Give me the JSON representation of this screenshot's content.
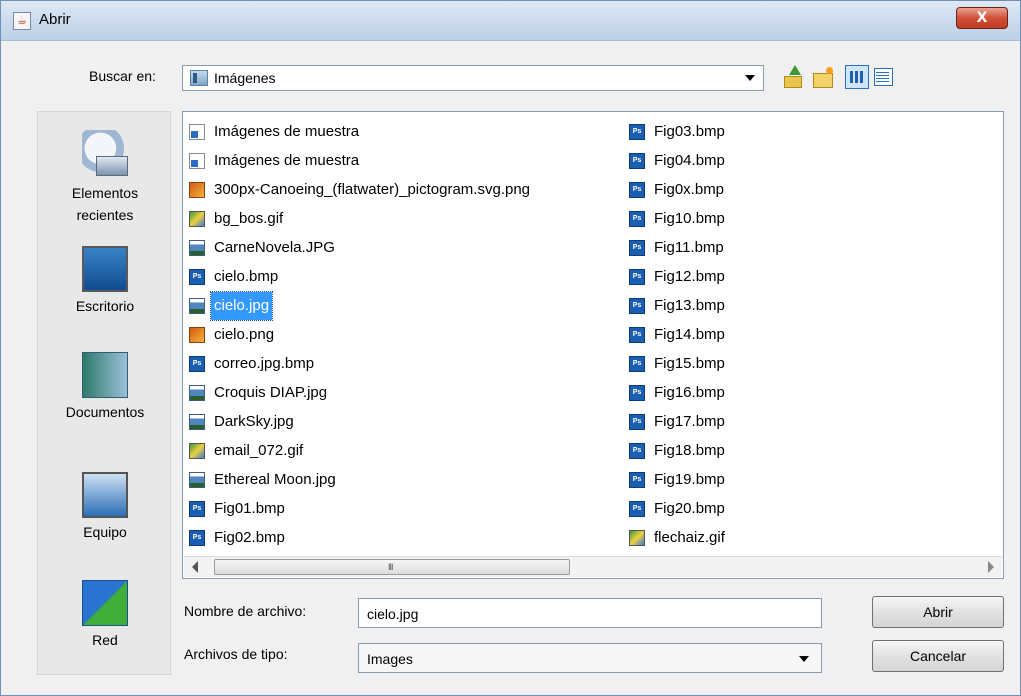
{
  "window": {
    "title": "Abrir",
    "close_label": "X"
  },
  "look_in": {
    "label": "Buscar en:",
    "value": "Imágenes"
  },
  "toolbar": {
    "buttons": [
      "up-one-level-icon",
      "create-new-folder-icon",
      "list-view-icon",
      "details-view-icon"
    ]
  },
  "places": [
    {
      "label": "Elementos\nrecientes",
      "icon": "recent-items-icon"
    },
    {
      "label": "Escritorio",
      "icon": "desktop-icon"
    },
    {
      "label": "Documentos",
      "icon": "documents-icon"
    },
    {
      "label": "Equipo",
      "icon": "computer-icon"
    },
    {
      "label": "Red",
      "icon": "network-icon"
    }
  ],
  "files_col1": [
    {
      "name": "Imágenes de muestra",
      "icon": "shortcut-folder-icon"
    },
    {
      "name": "Imágenes de muestra",
      "icon": "shortcut-folder-icon"
    },
    {
      "name": "300px-Canoeing_(flatwater)_pictogram.svg.png",
      "icon": "png-file-icon"
    },
    {
      "name": "bg_bos.gif",
      "icon": "gif-file-icon"
    },
    {
      "name": "CarneNovela.JPG",
      "icon": "jpg-file-icon"
    },
    {
      "name": "cielo.bmp",
      "icon": "bmp-file-icon"
    },
    {
      "name": "cielo.jpg",
      "icon": "jpg-file-icon",
      "selected": true
    },
    {
      "name": "cielo.png",
      "icon": "png-file-icon"
    },
    {
      "name": "correo.jpg.bmp",
      "icon": "bmp-file-icon"
    },
    {
      "name": "Croquis DIAP.jpg",
      "icon": "jpg-file-icon"
    },
    {
      "name": "DarkSky.jpg",
      "icon": "jpg-file-icon"
    },
    {
      "name": "email_072.gif",
      "icon": "gif-file-icon"
    },
    {
      "name": "Ethereal Moon.jpg",
      "icon": "jpg-file-icon"
    },
    {
      "name": "Fig01.bmp",
      "icon": "bmp-file-icon"
    },
    {
      "name": "Fig02.bmp",
      "icon": "bmp-file-icon"
    }
  ],
  "files_col2": [
    {
      "name": "Fig03.bmp",
      "icon": "bmp-file-icon"
    },
    {
      "name": "Fig04.bmp",
      "icon": "bmp-file-icon"
    },
    {
      "name": "Fig0x.bmp",
      "icon": "bmp-file-icon"
    },
    {
      "name": "Fig10.bmp",
      "icon": "bmp-file-icon"
    },
    {
      "name": "Fig11.bmp",
      "icon": "bmp-file-icon"
    },
    {
      "name": "Fig12.bmp",
      "icon": "bmp-file-icon"
    },
    {
      "name": "Fig13.bmp",
      "icon": "bmp-file-icon"
    },
    {
      "name": "Fig14.bmp",
      "icon": "bmp-file-icon"
    },
    {
      "name": "Fig15.bmp",
      "icon": "bmp-file-icon"
    },
    {
      "name": "Fig16.bmp",
      "icon": "bmp-file-icon"
    },
    {
      "name": "Fig17.bmp",
      "icon": "bmp-file-icon"
    },
    {
      "name": "Fig18.bmp",
      "icon": "bmp-file-icon"
    },
    {
      "name": "Fig19.bmp",
      "icon": "bmp-file-icon"
    },
    {
      "name": "Fig20.bmp",
      "icon": "bmp-file-icon"
    },
    {
      "name": "flechaiz.gif",
      "icon": "gif-file-icon"
    }
  ],
  "file_name": {
    "label": "Nombre de archivo:",
    "value": "cielo.jpg"
  },
  "file_type": {
    "label": "Archivos de tipo:",
    "value": "Images"
  },
  "buttons": {
    "open_label": "Abrir",
    "cancel_label": "Cancelar"
  },
  "scrollbar": {
    "grip": "III"
  },
  "colors": {
    "selection": "#3399ff",
    "close_button": "#d0513a",
    "bmp_icon": "#1b5fb3"
  }
}
